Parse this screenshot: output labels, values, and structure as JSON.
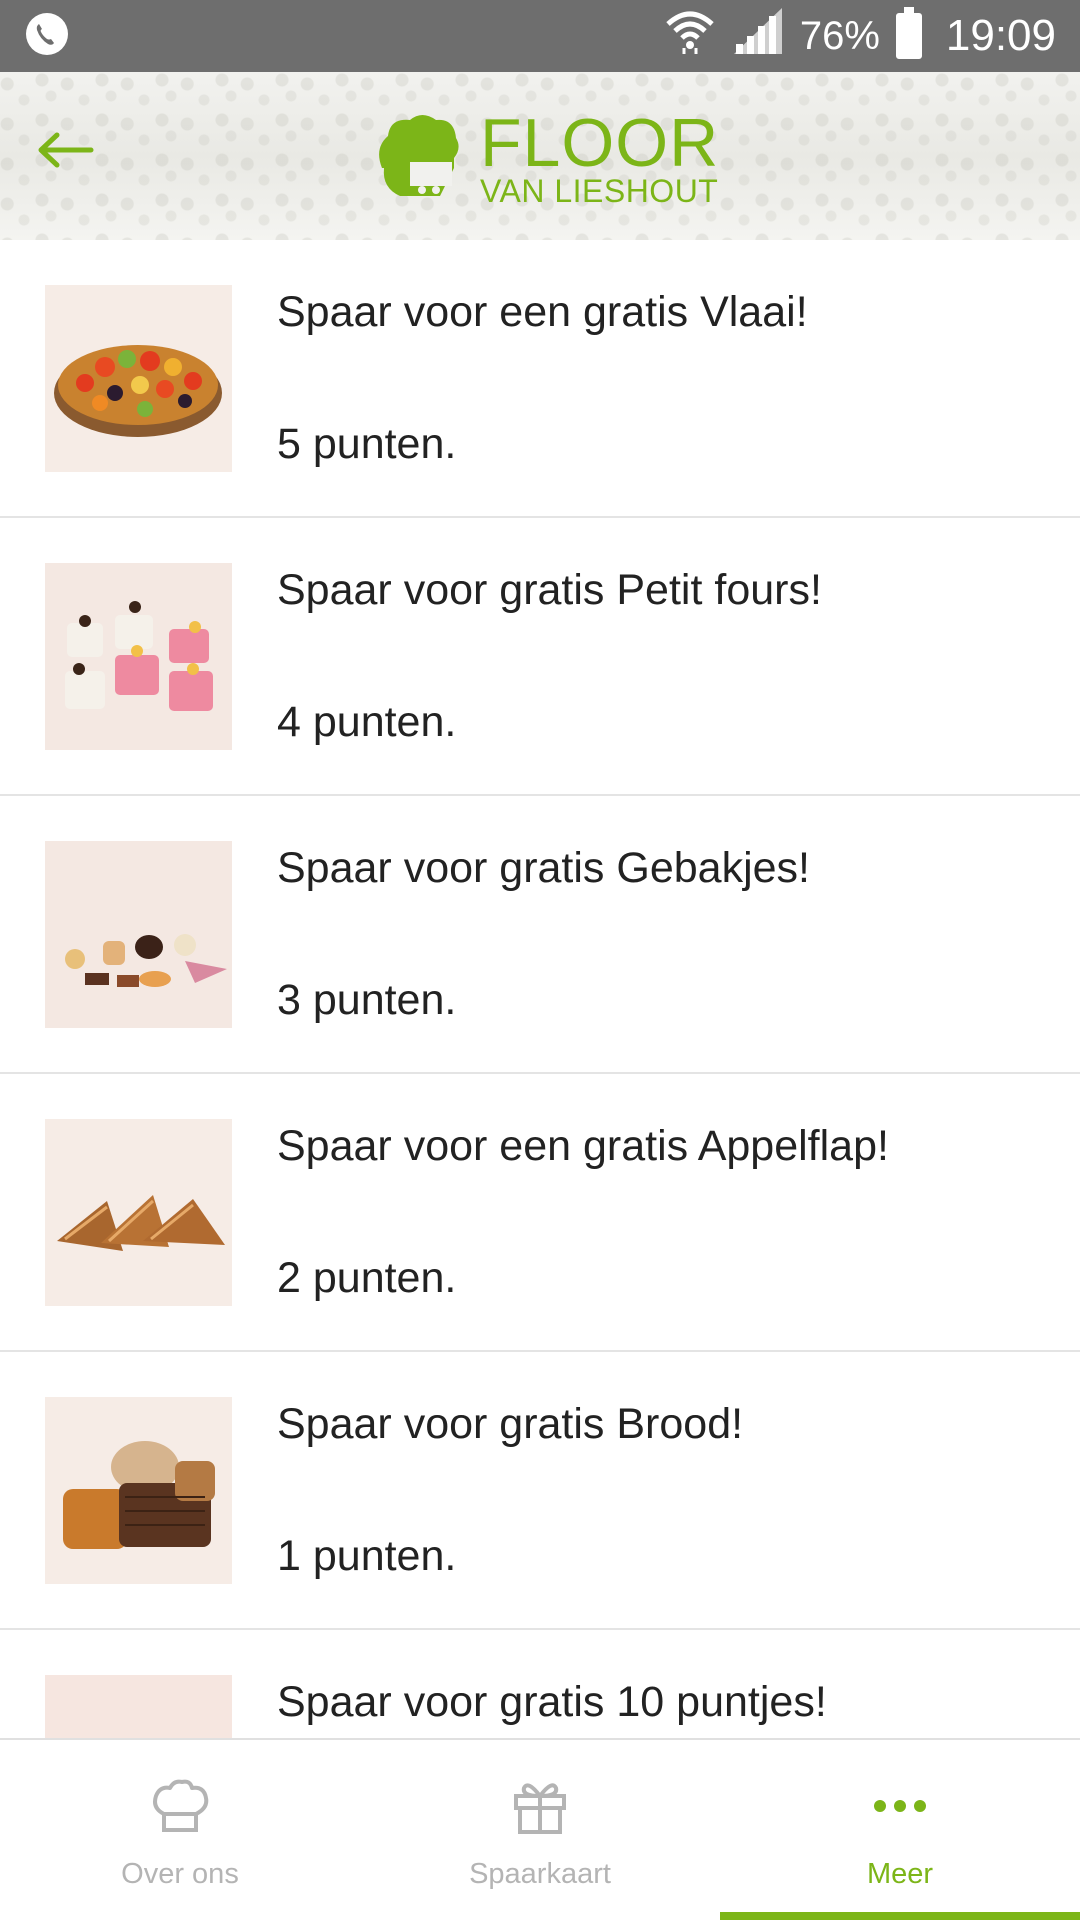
{
  "status_bar": {
    "battery_percent": "76%",
    "time": "19:09"
  },
  "header": {
    "logo_main": "FLOOR",
    "logo_sub": "VAN LIESHOUT",
    "brand_color": "#7cb518"
  },
  "rewards": [
    {
      "title": "Spaar voor een gratis Vlaai!",
      "points": "5 punten.",
      "icon": "fruit-tart-image"
    },
    {
      "title": "Spaar voor gratis Petit fours!",
      "points": "4 punten.",
      "icon": "petit-fours-image"
    },
    {
      "title": "Spaar voor gratis Gebakjes!",
      "points": "3 punten.",
      "icon": "pastries-image"
    },
    {
      "title": "Spaar voor een gratis Appelflap!",
      "points": "2 punten.",
      "icon": "apple-turnover-image"
    },
    {
      "title": "Spaar voor gratis Brood!",
      "points": "1 punten.",
      "icon": "bread-image"
    },
    {
      "title": "Spaar voor gratis 10 puntjes!",
      "points": "",
      "icon": "rolls-image"
    }
  ],
  "bottom_nav": {
    "tabs": [
      {
        "label": "Over ons",
        "icon": "chef-hat-icon",
        "active": false
      },
      {
        "label": "Spaarkaart",
        "icon": "gift-icon",
        "active": false
      },
      {
        "label": "Meer",
        "icon": "more-dots-icon",
        "active": true
      }
    ]
  }
}
